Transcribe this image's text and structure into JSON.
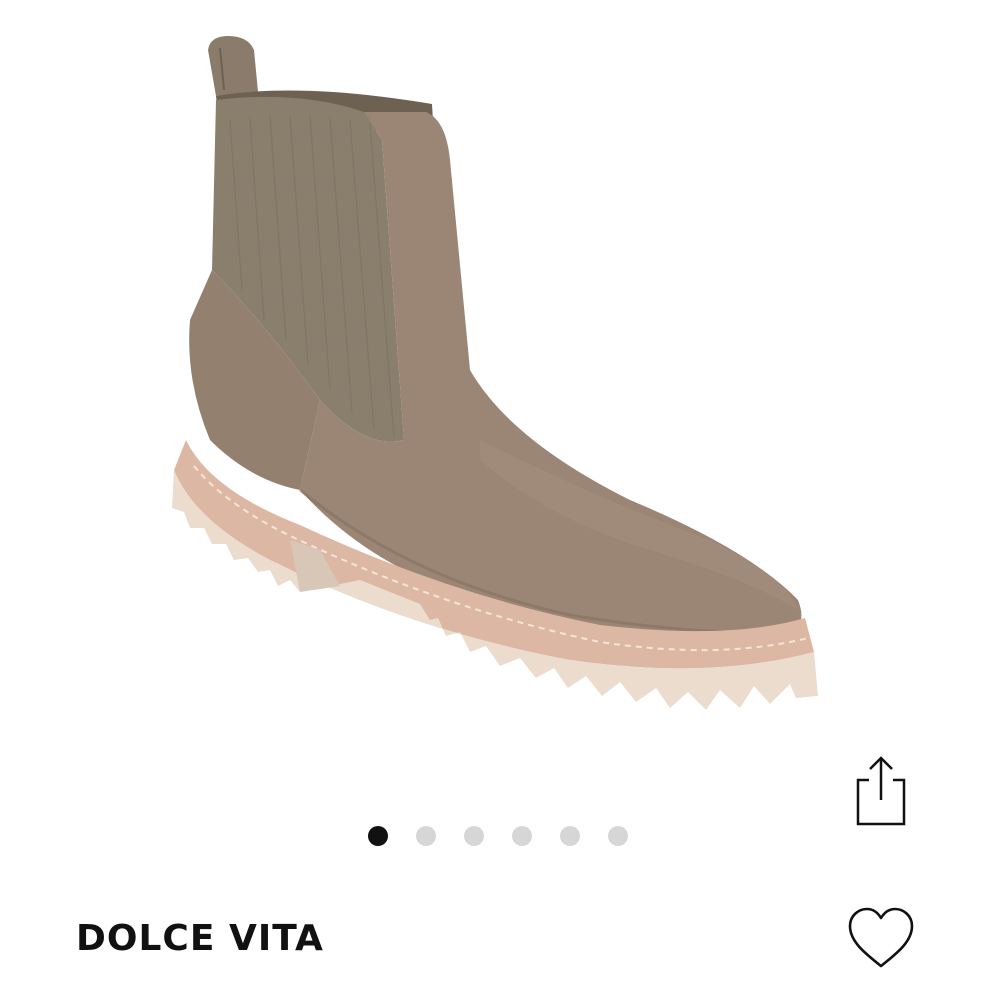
{
  "product": {
    "brand": "DOLCE VITA",
    "image_icon": "boot-product-image",
    "colors": {
      "suede": "#9a8575",
      "elastic": "#857a6a",
      "sole": "#ecdccd",
      "welt": "#dcb8a4"
    }
  },
  "carousel": {
    "total_slides": 6,
    "active_slide": 1
  },
  "actions": {
    "share_icon": "share-icon",
    "favorite_icon": "heart-icon"
  },
  "theme": {
    "dot_active": "#111111",
    "dot_inactive": "#d6d6d6",
    "text": "#111111"
  }
}
